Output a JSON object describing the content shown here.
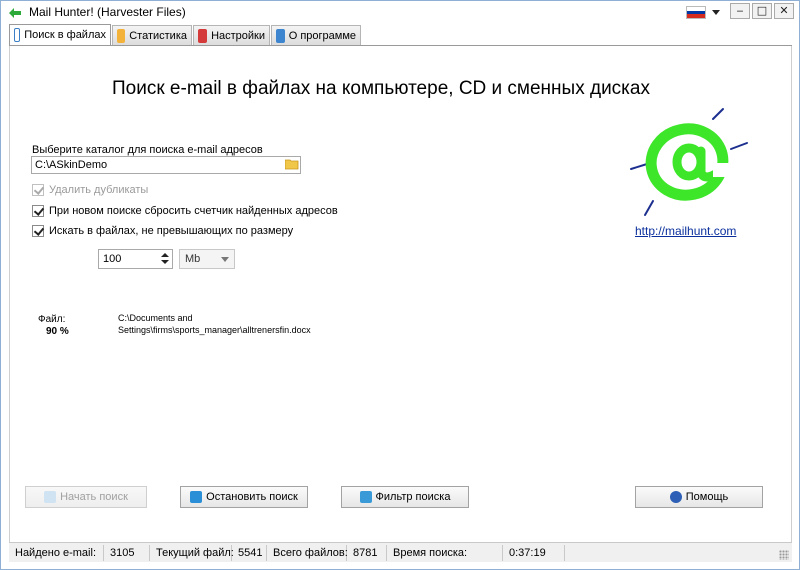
{
  "window": {
    "title": "Mail Hunter! (Harvester Files)",
    "min_glyph": "‒",
    "max_glyph": "□",
    "close_glyph": "✕"
  },
  "tabs": [
    {
      "label": "Поиск в файлах",
      "icon": "search-files-icon",
      "active": true
    },
    {
      "label": "Статистика",
      "icon": "statistics-icon",
      "active": false
    },
    {
      "label": "Настройки",
      "icon": "settings-icon",
      "active": false
    },
    {
      "label": "О программе",
      "icon": "about-icon",
      "active": false
    }
  ],
  "main": {
    "heading": "Поиск e-mail в файлах на компьютере, CD и сменных дисках",
    "dir_label": "Выберите каталог для поиска e-mail адресов",
    "dir_value": "C:\\ASkinDemo",
    "options": {
      "remove_duplicates": "Удалить дубликаты",
      "reset_counter": "При новом поиске сбросить счетчик найденных адресов",
      "size_limit": "Искать в файлах, не превышающих по размеру"
    },
    "size_value": "100",
    "size_unit": "Mb",
    "site_link": "http://mailhunt.com",
    "file_label": "Файл:",
    "file_percent": "90 %",
    "file_path": "C:\\Documents and Settings\\firms\\sports_manager\\alltrenersfin.docx"
  },
  "buttons": {
    "start": "Начать поиск",
    "stop": "Остановить поиск",
    "filter": "Фильтр поиска",
    "help": "Помощь"
  },
  "status": {
    "found_label": "Найдено e-mail:",
    "found_value": "3105",
    "current_label": "Текущий файл:",
    "current_value": "5541",
    "total_label": "Всего файлов:",
    "total_value": "8781",
    "time_label": "Время поиска:",
    "time_value": "0:37:19"
  },
  "colors": {
    "at_green": "#3ee62a",
    "at_rays": "#1c2f8f",
    "link": "#0a2f9c"
  }
}
